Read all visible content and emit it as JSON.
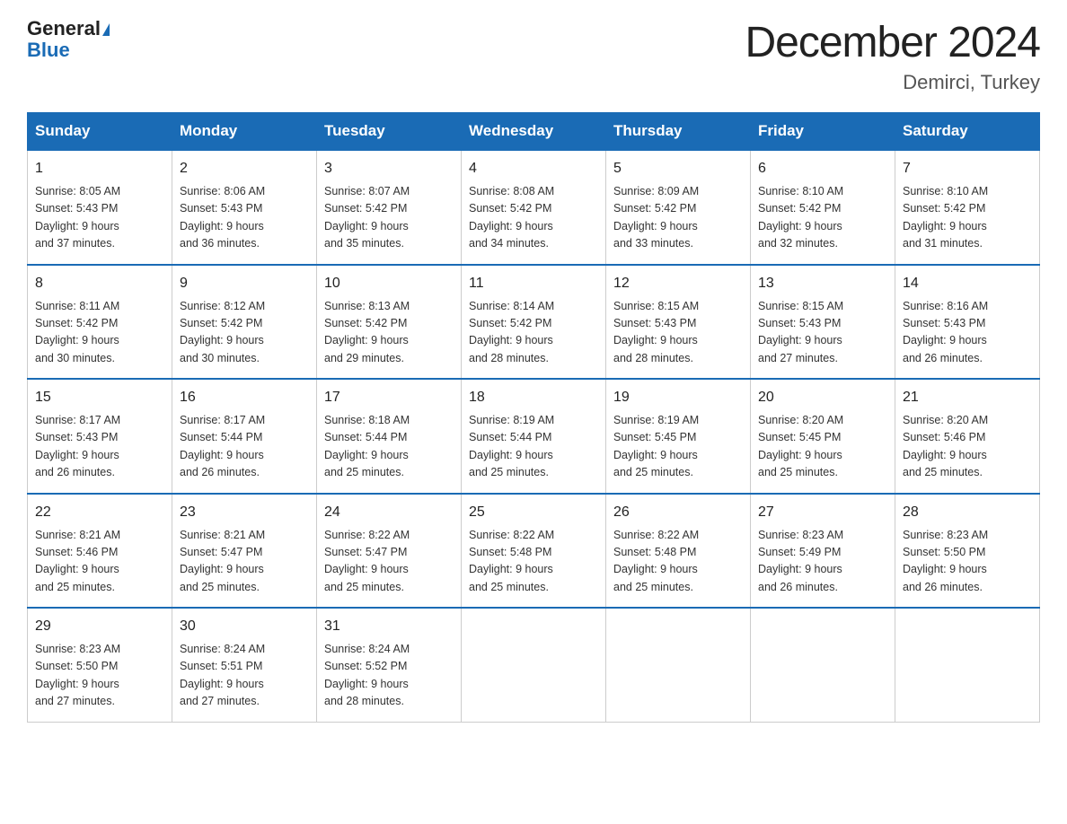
{
  "header": {
    "logo_line1": "General",
    "logo_line2": "Blue",
    "title": "December 2024",
    "subtitle": "Demirci, Turkey"
  },
  "days_of_week": [
    "Sunday",
    "Monday",
    "Tuesday",
    "Wednesday",
    "Thursday",
    "Friday",
    "Saturday"
  ],
  "weeks": [
    [
      {
        "day": "1",
        "info": "Sunrise: 8:05 AM\nSunset: 5:43 PM\nDaylight: 9 hours\nand 37 minutes."
      },
      {
        "day": "2",
        "info": "Sunrise: 8:06 AM\nSunset: 5:43 PM\nDaylight: 9 hours\nand 36 minutes."
      },
      {
        "day": "3",
        "info": "Sunrise: 8:07 AM\nSunset: 5:42 PM\nDaylight: 9 hours\nand 35 minutes."
      },
      {
        "day": "4",
        "info": "Sunrise: 8:08 AM\nSunset: 5:42 PM\nDaylight: 9 hours\nand 34 minutes."
      },
      {
        "day": "5",
        "info": "Sunrise: 8:09 AM\nSunset: 5:42 PM\nDaylight: 9 hours\nand 33 minutes."
      },
      {
        "day": "6",
        "info": "Sunrise: 8:10 AM\nSunset: 5:42 PM\nDaylight: 9 hours\nand 32 minutes."
      },
      {
        "day": "7",
        "info": "Sunrise: 8:10 AM\nSunset: 5:42 PM\nDaylight: 9 hours\nand 31 minutes."
      }
    ],
    [
      {
        "day": "8",
        "info": "Sunrise: 8:11 AM\nSunset: 5:42 PM\nDaylight: 9 hours\nand 30 minutes."
      },
      {
        "day": "9",
        "info": "Sunrise: 8:12 AM\nSunset: 5:42 PM\nDaylight: 9 hours\nand 30 minutes."
      },
      {
        "day": "10",
        "info": "Sunrise: 8:13 AM\nSunset: 5:42 PM\nDaylight: 9 hours\nand 29 minutes."
      },
      {
        "day": "11",
        "info": "Sunrise: 8:14 AM\nSunset: 5:42 PM\nDaylight: 9 hours\nand 28 minutes."
      },
      {
        "day": "12",
        "info": "Sunrise: 8:15 AM\nSunset: 5:43 PM\nDaylight: 9 hours\nand 28 minutes."
      },
      {
        "day": "13",
        "info": "Sunrise: 8:15 AM\nSunset: 5:43 PM\nDaylight: 9 hours\nand 27 minutes."
      },
      {
        "day": "14",
        "info": "Sunrise: 8:16 AM\nSunset: 5:43 PM\nDaylight: 9 hours\nand 26 minutes."
      }
    ],
    [
      {
        "day": "15",
        "info": "Sunrise: 8:17 AM\nSunset: 5:43 PM\nDaylight: 9 hours\nand 26 minutes."
      },
      {
        "day": "16",
        "info": "Sunrise: 8:17 AM\nSunset: 5:44 PM\nDaylight: 9 hours\nand 26 minutes."
      },
      {
        "day": "17",
        "info": "Sunrise: 8:18 AM\nSunset: 5:44 PM\nDaylight: 9 hours\nand 25 minutes."
      },
      {
        "day": "18",
        "info": "Sunrise: 8:19 AM\nSunset: 5:44 PM\nDaylight: 9 hours\nand 25 minutes."
      },
      {
        "day": "19",
        "info": "Sunrise: 8:19 AM\nSunset: 5:45 PM\nDaylight: 9 hours\nand 25 minutes."
      },
      {
        "day": "20",
        "info": "Sunrise: 8:20 AM\nSunset: 5:45 PM\nDaylight: 9 hours\nand 25 minutes."
      },
      {
        "day": "21",
        "info": "Sunrise: 8:20 AM\nSunset: 5:46 PM\nDaylight: 9 hours\nand 25 minutes."
      }
    ],
    [
      {
        "day": "22",
        "info": "Sunrise: 8:21 AM\nSunset: 5:46 PM\nDaylight: 9 hours\nand 25 minutes."
      },
      {
        "day": "23",
        "info": "Sunrise: 8:21 AM\nSunset: 5:47 PM\nDaylight: 9 hours\nand 25 minutes."
      },
      {
        "day": "24",
        "info": "Sunrise: 8:22 AM\nSunset: 5:47 PM\nDaylight: 9 hours\nand 25 minutes."
      },
      {
        "day": "25",
        "info": "Sunrise: 8:22 AM\nSunset: 5:48 PM\nDaylight: 9 hours\nand 25 minutes."
      },
      {
        "day": "26",
        "info": "Sunrise: 8:22 AM\nSunset: 5:48 PM\nDaylight: 9 hours\nand 25 minutes."
      },
      {
        "day": "27",
        "info": "Sunrise: 8:23 AM\nSunset: 5:49 PM\nDaylight: 9 hours\nand 26 minutes."
      },
      {
        "day": "28",
        "info": "Sunrise: 8:23 AM\nSunset: 5:50 PM\nDaylight: 9 hours\nand 26 minutes."
      }
    ],
    [
      {
        "day": "29",
        "info": "Sunrise: 8:23 AM\nSunset: 5:50 PM\nDaylight: 9 hours\nand 27 minutes."
      },
      {
        "day": "30",
        "info": "Sunrise: 8:24 AM\nSunset: 5:51 PM\nDaylight: 9 hours\nand 27 minutes."
      },
      {
        "day": "31",
        "info": "Sunrise: 8:24 AM\nSunset: 5:52 PM\nDaylight: 9 hours\nand 28 minutes."
      },
      {
        "day": "",
        "info": ""
      },
      {
        "day": "",
        "info": ""
      },
      {
        "day": "",
        "info": ""
      },
      {
        "day": "",
        "info": ""
      }
    ]
  ]
}
